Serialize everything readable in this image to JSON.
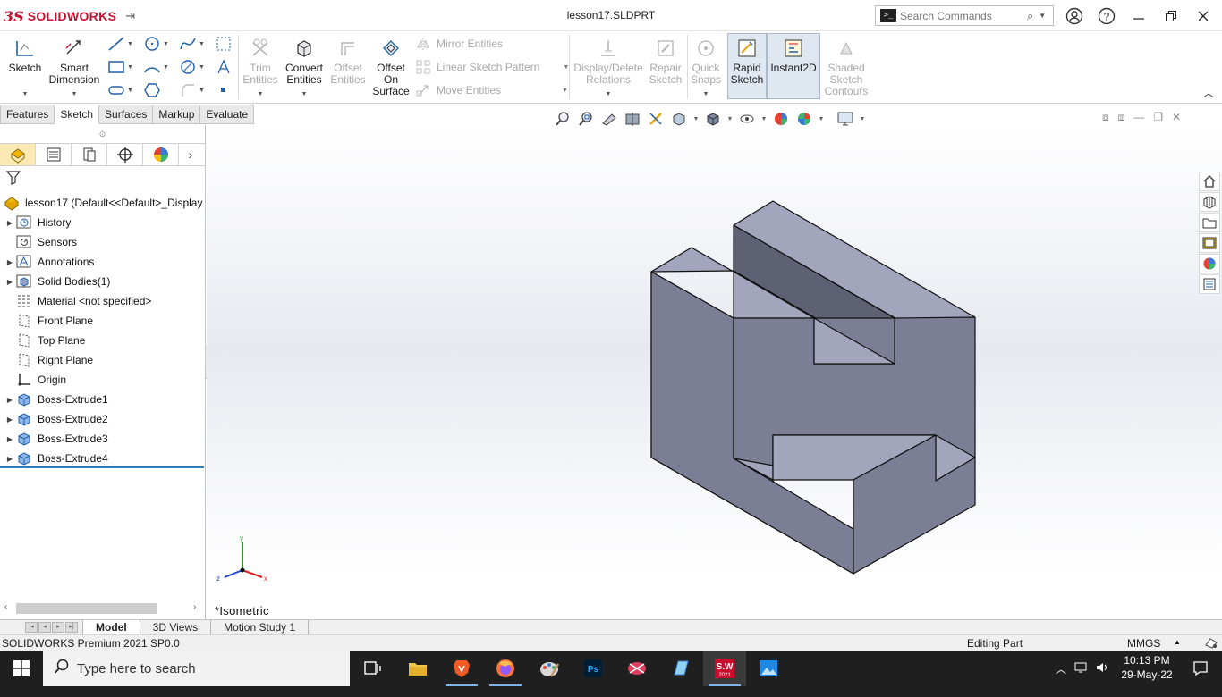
{
  "app": {
    "brand": "SOLIDWORKS",
    "brand_prefix": "3S",
    "document_title": "lesson17.SLDPRT"
  },
  "search": {
    "placeholder": "Search Commands"
  },
  "ribbon": {
    "sketch": "Sketch",
    "smart_dimension": [
      "Smart",
      "Dimension"
    ],
    "trim_entities": [
      "Trim",
      "Entities"
    ],
    "convert_entities": [
      "Convert",
      "Entities"
    ],
    "offset_entities": [
      "Offset",
      "Entities"
    ],
    "offset_on_surface": [
      "Offset",
      "On",
      "Surface"
    ],
    "mirror_entities": "Mirror Entities",
    "linear_sketch_pattern": "Linear Sketch Pattern",
    "move_entities": "Move Entities",
    "display_delete_relations": [
      "Display/Delete",
      "Relations"
    ],
    "repair_sketch": [
      "Repair",
      "Sketch"
    ],
    "quick_snaps": [
      "Quick",
      "Snaps"
    ],
    "rapid_sketch": [
      "Rapid",
      "Sketch"
    ],
    "instant2d": "Instant2D",
    "shaded_sketch_contours": [
      "Shaded",
      "Sketch",
      "Contours"
    ]
  },
  "cm_tabs": [
    {
      "label": "Features",
      "active": false
    },
    {
      "label": "Sketch",
      "active": true
    },
    {
      "label": "Surfaces",
      "active": false
    },
    {
      "label": "Markup",
      "active": false
    },
    {
      "label": "Evaluate",
      "active": false
    }
  ],
  "tree": {
    "root": "lesson17  (Default<<Default>_Display",
    "items": [
      {
        "label": "History",
        "icon": "history-icon",
        "expandable": true
      },
      {
        "label": "Sensors",
        "icon": "sensors-icon",
        "expandable": false
      },
      {
        "label": "Annotations",
        "icon": "annotations-icon",
        "expandable": true
      },
      {
        "label": "Solid Bodies(1)",
        "icon": "solid-bodies-icon",
        "expandable": true
      },
      {
        "label": "Material <not specified>",
        "icon": "material-icon",
        "expandable": false
      },
      {
        "label": "Front Plane",
        "icon": "plane-icon",
        "expandable": false
      },
      {
        "label": "Top Plane",
        "icon": "plane-icon",
        "expandable": false
      },
      {
        "label": "Right Plane",
        "icon": "plane-icon",
        "expandable": false
      },
      {
        "label": "Origin",
        "icon": "origin-icon",
        "expandable": false
      },
      {
        "label": "Boss-Extrude1",
        "icon": "boss-extrude-icon",
        "expandable": true
      },
      {
        "label": "Boss-Extrude2",
        "icon": "boss-extrude-icon",
        "expandable": true
      },
      {
        "label": "Boss-Extrude3",
        "icon": "boss-extrude-icon",
        "expandable": true
      },
      {
        "label": "Boss-Extrude4",
        "icon": "boss-extrude-icon",
        "expandable": true
      }
    ]
  },
  "viewport": {
    "view_label": "*Isometric",
    "triad": {
      "x": "x",
      "y": "y",
      "z": "z"
    }
  },
  "bottom_tabs": [
    {
      "label": "Model",
      "active": true
    },
    {
      "label": "3D Views",
      "active": false
    },
    {
      "label": "Motion Study 1",
      "active": false
    }
  ],
  "status": {
    "product": "SOLIDWORKS Premium 2021 SP0.0",
    "mode": "Editing Part",
    "units": "MMGS"
  },
  "taskbar": {
    "search_placeholder": "Type here to search",
    "time": "10:13 PM",
    "date": "29-May-22",
    "sw_badge": "2021"
  },
  "colors": {
    "brand_red": "#c8102e",
    "model_face_top": "#a3a5bd",
    "model_face_front": "#7c7e96",
    "model_face_side": "#5e6074",
    "accent_blue": "#2f7fbf",
    "taskbar": "#1f1f1f"
  }
}
